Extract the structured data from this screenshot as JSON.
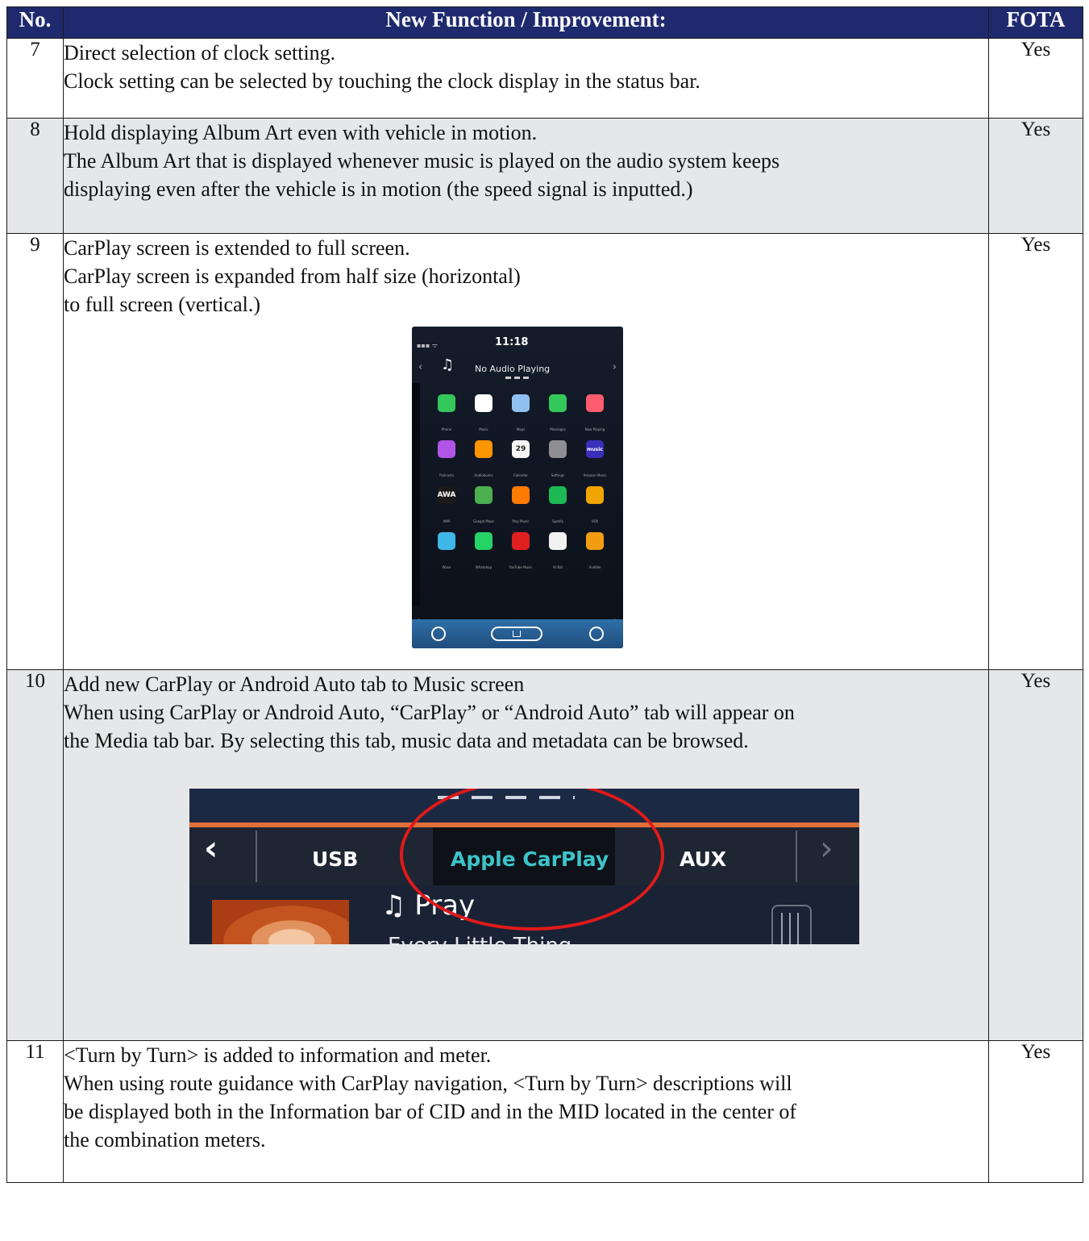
{
  "header": {
    "no": "No.",
    "function": "New Function / Improvement:",
    "fota": "FOTA"
  },
  "rows": [
    {
      "no": "7",
      "fota": "Yes",
      "lines": [
        "Direct selection of clock setting.",
        "Clock setting can be selected by touching the clock display in the status bar."
      ]
    },
    {
      "no": "8",
      "fota": "Yes",
      "lines": [
        "Hold displaying Album Art even with vehicle in motion.",
        "The Album Art that is displayed whenever music is played on the audio system keeps",
        "displaying even after the vehicle is in motion (the speed signal is inputted.)"
      ]
    },
    {
      "no": "9",
      "fota": "Yes",
      "lines": [
        "CarPlay screen is extended to full screen.",
        "CarPlay screen is expanded from half size (horizontal)",
        "to full screen (vertical.)"
      ]
    },
    {
      "no": "10",
      "fota": "Yes",
      "lines": [
        "Add new CarPlay or Android Auto tab to Music screen",
        "When using CarPlay or Android Auto, “CarPlay” or “Android Auto” tab will appear on",
        "the Media tab bar. By selecting this tab, music data and metadata can be browsed."
      ]
    },
    {
      "no": "11",
      "fota": "Yes",
      "lines": [
        "<Turn by Turn> is added to information and meter.",
        "When using route guidance with CarPlay navigation, <Turn by Turn> descriptions will",
        "be displayed both in the Information bar of CID and in the MID located in the center of",
        "the combination meters."
      ]
    }
  ],
  "carplay_screen": {
    "clock": "11:18",
    "now_playing": "No Audio Playing",
    "apps": [
      {
        "name": "Phone",
        "icon": "phone-icon",
        "color": "#34c759"
      },
      {
        "name": "Music",
        "icon": "music-icon",
        "color": "#ffffff"
      },
      {
        "name": "Maps",
        "icon": "maps-icon",
        "color": "#8fc0f0"
      },
      {
        "name": "Messages",
        "icon": "messages-icon",
        "color": "#34c759"
      },
      {
        "name": "Now Playing",
        "icon": "now-playing-icon",
        "color": "#ff5c6e"
      },
      {
        "name": "Podcasts",
        "icon": "podcasts-icon",
        "color": "#b055e6"
      },
      {
        "name": "Audiobooks",
        "icon": "audiobooks-icon",
        "color": "#ff9500"
      },
      {
        "name": "Calendar",
        "icon": "calendar-icon",
        "color": "#f5f5f5",
        "text": "29"
      },
      {
        "name": "Settings",
        "icon": "settings-icon",
        "color": "#8e8e93"
      },
      {
        "name": "Amazon Music",
        "icon": "amazon-music-icon",
        "color": "#3a2fb8",
        "text": "music"
      },
      {
        "name": "AWA",
        "icon": "awa-icon",
        "color": "#1a1a1a",
        "text": "AWA"
      },
      {
        "name": "Google Maps",
        "icon": "google-maps-icon",
        "color": "#4caf50"
      },
      {
        "name": "Play Music",
        "icon": "play-music-icon",
        "color": "#ff7a00"
      },
      {
        "name": "Spotify",
        "icon": "spotify-icon",
        "color": "#1db954"
      },
      {
        "name": "VOX",
        "icon": "vox-icon",
        "color": "#f0a500"
      },
      {
        "name": "Waze",
        "icon": "waze-icon",
        "color": "#3fb7e8"
      },
      {
        "name": "WhatsApp",
        "icon": "whatsapp-icon",
        "color": "#25d366"
      },
      {
        "name": "YouTube Music",
        "icon": "youtube-music-icon",
        "color": "#e02020"
      },
      {
        "name": "At Bat",
        "icon": "at-bat-icon",
        "color": "#f2f2f2"
      },
      {
        "name": "Audible",
        "icon": "audible-icon",
        "color": "#f39c12"
      }
    ]
  },
  "media_tab_bar": {
    "tabs": [
      "USB",
      "Apple CarPlay",
      "AUX"
    ],
    "active_tab": "Apple CarPlay",
    "song": "♫ Pray",
    "artist": "Every Little Thing",
    "highlight_color": "#e01a1a",
    "accent_color": "#e0703a"
  },
  "colors": {
    "header_bg": "#1f2a6e",
    "shade_row": "#e6e7e9"
  }
}
